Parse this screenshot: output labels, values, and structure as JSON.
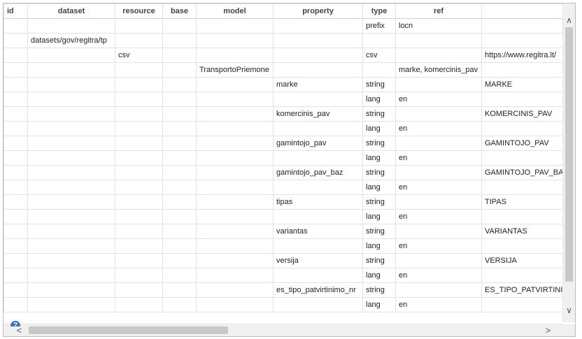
{
  "columns": [
    "id",
    "dataset",
    "resource",
    "base",
    "model",
    "property",
    "type",
    "ref",
    ""
  ],
  "rows": [
    [
      "",
      "",
      "",
      "",
      "",
      "",
      "prefix",
      "locn",
      ""
    ],
    [
      "",
      "datasets/gov/regitra/tp",
      "",
      "",
      "",
      "",
      "",
      "",
      ""
    ],
    [
      "",
      "",
      "csv",
      "",
      "",
      "",
      "csv",
      "",
      "https://www.regitra.lt/"
    ],
    [
      "",
      "",
      "",
      "",
      "TransportoPriemone",
      "",
      "",
      "marke, komercinis_pav",
      ""
    ],
    [
      "",
      "",
      "",
      "",
      "",
      "marke",
      "string",
      "",
      "MARKE"
    ],
    [
      "",
      "",
      "",
      "",
      "",
      "",
      "lang",
      "en",
      ""
    ],
    [
      "",
      "",
      "",
      "",
      "",
      "komercinis_pav",
      "string",
      "",
      "KOMERCINIS_PAV"
    ],
    [
      "",
      "",
      "",
      "",
      "",
      "",
      "lang",
      "en",
      ""
    ],
    [
      "",
      "",
      "",
      "",
      "",
      "gamintojo_pav",
      "string",
      "",
      "GAMINTOJO_PAV"
    ],
    [
      "",
      "",
      "",
      "",
      "",
      "",
      "lang",
      "en",
      ""
    ],
    [
      "",
      "",
      "",
      "",
      "",
      "gamintojo_pav_baz",
      "string",
      "",
      "GAMINTOJO_PAV_BAZ"
    ],
    [
      "",
      "",
      "",
      "",
      "",
      "",
      "lang",
      "en",
      ""
    ],
    [
      "",
      "",
      "",
      "",
      "",
      "tipas",
      "string",
      "",
      "TIPAS"
    ],
    [
      "",
      "",
      "",
      "",
      "",
      "",
      "lang",
      "en",
      ""
    ],
    [
      "",
      "",
      "",
      "",
      "",
      "variantas",
      "string",
      "",
      "VARIANTAS"
    ],
    [
      "",
      "",
      "",
      "",
      "",
      "",
      "lang",
      "en",
      ""
    ],
    [
      "",
      "",
      "",
      "",
      "",
      "versija",
      "string",
      "",
      "VERSIJA"
    ],
    [
      "",
      "",
      "",
      "",
      "",
      "",
      "lang",
      "en",
      ""
    ],
    [
      "",
      "",
      "",
      "",
      "",
      "es_tipo_patvirtinimo_nr",
      "string",
      "",
      "ES_TIPO_PATVIRTINIMO"
    ],
    [
      "",
      "",
      "",
      "",
      "",
      "",
      "lang",
      "en",
      ""
    ]
  ],
  "scrollbars": {
    "up": "∧",
    "down": "∨",
    "left": "<",
    "right": ">"
  },
  "help_icon": {
    "icon": "help-icon",
    "glyph": "?"
  }
}
